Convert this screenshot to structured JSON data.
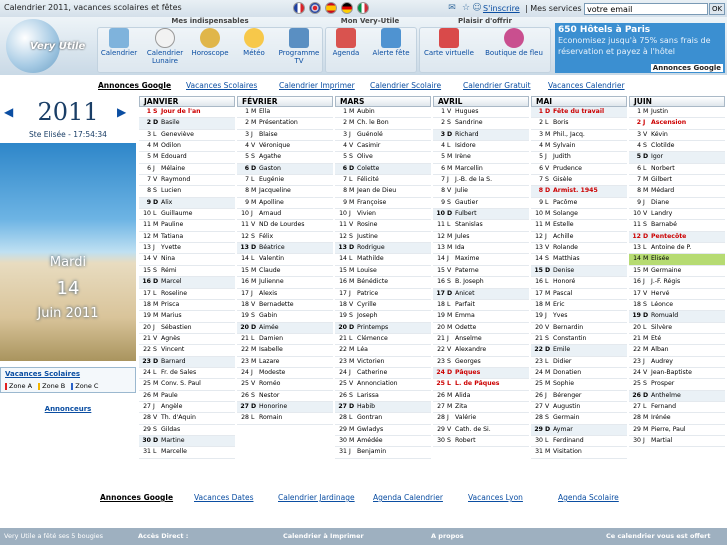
{
  "top": {
    "title": "Calendrier 2011, vacances scolaires et fêtes",
    "inscrire": "S'inscrire",
    "services_label": "| Mes services :",
    "email_value": "votre email",
    "ok": "OK",
    "flags": [
      "fr",
      "uk",
      "de",
      "es",
      "it"
    ]
  },
  "nav": {
    "groups": [
      {
        "title": "Mes indispensables"
      },
      {
        "title": "Mon Very-Utile"
      },
      {
        "title": "Plaisir d'offrir"
      }
    ],
    "buttons": [
      {
        "label": "Calendrier",
        "icon": "calendar-icon",
        "color": "#7fb3dc"
      },
      {
        "label": "Calendrier Lunaire",
        "icon": "moon-icon",
        "color": "#f2f2f2"
      },
      {
        "label": "Horoscope",
        "icon": "zodiac-icon",
        "color": "#e0b64a"
      },
      {
        "label": "Météo",
        "icon": "weather-icon",
        "color": "#f7c84a"
      },
      {
        "label": "Programme TV",
        "icon": "tv-icon",
        "color": "#5a8fc2"
      },
      {
        "label": "Agenda",
        "icon": "agenda-icon",
        "color": "#d9534f"
      },
      {
        "label": "Alerte fête",
        "icon": "mail-alert-icon",
        "color": "#4f93d1"
      },
      {
        "label": "Carte virtuelle",
        "icon": "greeting-card-icon",
        "color": "#d94a4a"
      },
      {
        "label": "Boutique de fleu",
        "icon": "flower-icon",
        "color": "#c94f8f"
      }
    ]
  },
  "promo": {
    "title": "650 Hôtels à Paris",
    "text": "Economisez jusqu'à 75% sans frais de réservation et payez à l'hôtel",
    "url_text": "www.booking.com/Paris",
    "badge": "Annonces Google"
  },
  "linkbar": [
    "Annonces Google",
    "Vacances Scolaires",
    "Calendrier Imprimer",
    "Calendrier Scolaire",
    "Calendrier Gratuit",
    "Vacances Calendrier"
  ],
  "side": {
    "year": "2011",
    "place_time": "Ste Elisée - 17:54:34",
    "photo_day": "Mardi",
    "photo_date": "14",
    "photo_month": "Juin 2011",
    "vacs_title": "Vacances Scolaires",
    "zones": [
      "Zone A",
      "Zone B",
      "Zone C"
    ],
    "zone_colors": [
      "#e11f1f",
      "#f2b500",
      "#2a62c9"
    ],
    "annonceurs": "Annonceurs"
  },
  "months": [
    {
      "name": "JANVIER",
      "days": [
        [
          "1",
          "S",
          "Jour de l'an"
        ],
        [
          "2",
          "D",
          "Basile"
        ],
        [
          "3",
          "L",
          "Geneviève"
        ],
        [
          "4",
          "M",
          "Odilon"
        ],
        [
          "5",
          "M",
          "Edouard"
        ],
        [
          "6",
          "J",
          "Mélaine"
        ],
        [
          "7",
          "V",
          "Raymond"
        ],
        [
          "8",
          "S",
          "Lucien"
        ],
        [
          "9",
          "D",
          "Alix"
        ],
        [
          "10",
          "L",
          "Guillaume"
        ],
        [
          "11",
          "M",
          "Pauline"
        ],
        [
          "12",
          "M",
          "Tatiana"
        ],
        [
          "13",
          "J",
          "Yvette"
        ],
        [
          "14",
          "V",
          "Nina"
        ],
        [
          "15",
          "S",
          "Rémi"
        ],
        [
          "16",
          "D",
          "Marcel"
        ],
        [
          "17",
          "L",
          "Roseline"
        ],
        [
          "18",
          "M",
          "Prisca"
        ],
        [
          "19",
          "M",
          "Marius"
        ],
        [
          "20",
          "J",
          "Sébastien"
        ],
        [
          "21",
          "V",
          "Agnès"
        ],
        [
          "22",
          "S",
          "Vincent"
        ],
        [
          "23",
          "D",
          "Barnard"
        ],
        [
          "24",
          "L",
          "Fr. de Sales"
        ],
        [
          "25",
          "M",
          "Conv. S. Paul"
        ],
        [
          "26",
          "M",
          "Paule"
        ],
        [
          "27",
          "J",
          "Angèle"
        ],
        [
          "28",
          "V",
          "Th. d'Aquin"
        ],
        [
          "29",
          "S",
          "Gildas"
        ],
        [
          "30",
          "D",
          "Martine"
        ],
        [
          "31",
          "L",
          "Marcelle"
        ]
      ]
    },
    {
      "name": "FÉVRIER",
      "days": [
        [
          "1",
          "M",
          "Ella"
        ],
        [
          "2",
          "M",
          "Présentation"
        ],
        [
          "3",
          "J",
          "Blaise"
        ],
        [
          "4",
          "V",
          "Véronique"
        ],
        [
          "5",
          "S",
          "Agathe"
        ],
        [
          "6",
          "D",
          "Gaston"
        ],
        [
          "7",
          "L",
          "Eugénie"
        ],
        [
          "8",
          "M",
          "Jacqueline"
        ],
        [
          "9",
          "M",
          "Apolline"
        ],
        [
          "10",
          "J",
          "Arnaud"
        ],
        [
          "11",
          "V",
          "ND de Lourdes"
        ],
        [
          "12",
          "S",
          "Félix"
        ],
        [
          "13",
          "D",
          "Béatrice"
        ],
        [
          "14",
          "L",
          "Valentin"
        ],
        [
          "15",
          "M",
          "Claude"
        ],
        [
          "16",
          "M",
          "Julienne"
        ],
        [
          "17",
          "J",
          "Alexis"
        ],
        [
          "18",
          "V",
          "Bernadette"
        ],
        [
          "19",
          "S",
          "Gabin"
        ],
        [
          "20",
          "D",
          "Aimée"
        ],
        [
          "21",
          "L",
          "Damien"
        ],
        [
          "22",
          "M",
          "Isabelle"
        ],
        [
          "23",
          "M",
          "Lazare"
        ],
        [
          "24",
          "J",
          "Modeste"
        ],
        [
          "25",
          "V",
          "Roméo"
        ],
        [
          "26",
          "S",
          "Nestor"
        ],
        [
          "27",
          "D",
          "Honorine"
        ],
        [
          "28",
          "L",
          "Romain"
        ]
      ]
    },
    {
      "name": "MARS",
      "days": [
        [
          "1",
          "M",
          "Aubin"
        ],
        [
          "2",
          "M",
          "Ch. le Bon"
        ],
        [
          "3",
          "J",
          "Guénolé"
        ],
        [
          "4",
          "V",
          "Casimir"
        ],
        [
          "5",
          "S",
          "Olive"
        ],
        [
          "6",
          "D",
          "Colette"
        ],
        [
          "7",
          "L",
          "Félicité"
        ],
        [
          "8",
          "M",
          "Jean de Dieu"
        ],
        [
          "9",
          "M",
          "Françoise"
        ],
        [
          "10",
          "J",
          "Vivien"
        ],
        [
          "11",
          "V",
          "Rosine"
        ],
        [
          "12",
          "S",
          "Justine"
        ],
        [
          "13",
          "D",
          "Rodrigue"
        ],
        [
          "14",
          "L",
          "Mathilde"
        ],
        [
          "15",
          "M",
          "Louise"
        ],
        [
          "16",
          "M",
          "Bénédicte"
        ],
        [
          "17",
          "J",
          "Patrice"
        ],
        [
          "18",
          "V",
          "Cyrille"
        ],
        [
          "19",
          "S",
          "Joseph"
        ],
        [
          "20",
          "D",
          "Printemps"
        ],
        [
          "21",
          "L",
          "Clémence"
        ],
        [
          "22",
          "M",
          "Léa"
        ],
        [
          "23",
          "M",
          "Victorien"
        ],
        [
          "24",
          "J",
          "Catherine"
        ],
        [
          "25",
          "V",
          "Annonciation"
        ],
        [
          "26",
          "S",
          "Larissa"
        ],
        [
          "27",
          "D",
          "Habib"
        ],
        [
          "28",
          "L",
          "Gontran"
        ],
        [
          "29",
          "M",
          "Gwladys"
        ],
        [
          "30",
          "M",
          "Amédée"
        ],
        [
          "31",
          "J",
          "Benjamin"
        ]
      ]
    },
    {
      "name": "AVRIL",
      "days": [
        [
          "1",
          "V",
          "Hugues"
        ],
        [
          "2",
          "S",
          "Sandrine"
        ],
        [
          "3",
          "D",
          "Richard"
        ],
        [
          "4",
          "L",
          "Isidore"
        ],
        [
          "5",
          "M",
          "Irène"
        ],
        [
          "6",
          "M",
          "Marcellin"
        ],
        [
          "7",
          "J",
          "J.-B. de la S."
        ],
        [
          "8",
          "V",
          "Julie"
        ],
        [
          "9",
          "S",
          "Gautier"
        ],
        [
          "10",
          "D",
          "Fulbert"
        ],
        [
          "11",
          "L",
          "Stanislas"
        ],
        [
          "12",
          "M",
          "Jules"
        ],
        [
          "13",
          "M",
          "Ida"
        ],
        [
          "14",
          "J",
          "Maxime"
        ],
        [
          "15",
          "V",
          "Paterne"
        ],
        [
          "16",
          "S",
          "B. Joseph"
        ],
        [
          "17",
          "D",
          "Anicet"
        ],
        [
          "18",
          "L",
          "Parfait"
        ],
        [
          "19",
          "M",
          "Emma"
        ],
        [
          "20",
          "M",
          "Odette"
        ],
        [
          "21",
          "J",
          "Anselme"
        ],
        [
          "22",
          "V",
          "Alexandre"
        ],
        [
          "23",
          "S",
          "Georges"
        ],
        [
          "24",
          "D",
          "Pâques"
        ],
        [
          "25",
          "L",
          "L. de Pâques"
        ],
        [
          "26",
          "M",
          "Alida"
        ],
        [
          "27",
          "M",
          "Zita"
        ],
        [
          "28",
          "J",
          "Valérie"
        ],
        [
          "29",
          "V",
          "Cath. de Si."
        ],
        [
          "30",
          "S",
          "Robert"
        ]
      ]
    },
    {
      "name": "MAI",
      "days": [
        [
          "1",
          "D",
          "Fête du travail"
        ],
        [
          "2",
          "L",
          "Boris"
        ],
        [
          "3",
          "M",
          "Phil., Jacq."
        ],
        [
          "4",
          "M",
          "Sylvain"
        ],
        [
          "5",
          "J",
          "Judith"
        ],
        [
          "6",
          "V",
          "Prudence"
        ],
        [
          "7",
          "S",
          "Gisèle"
        ],
        [
          "8",
          "D",
          "Armist. 1945"
        ],
        [
          "9",
          "L",
          "Pacôme"
        ],
        [
          "10",
          "M",
          "Solange"
        ],
        [
          "11",
          "M",
          "Estelle"
        ],
        [
          "12",
          "J",
          "Achille"
        ],
        [
          "13",
          "V",
          "Rolande"
        ],
        [
          "14",
          "S",
          "Matthias"
        ],
        [
          "15",
          "D",
          "Denise"
        ],
        [
          "16",
          "L",
          "Honoré"
        ],
        [
          "17",
          "M",
          "Pascal"
        ],
        [
          "18",
          "M",
          "Eric"
        ],
        [
          "19",
          "J",
          "Yves"
        ],
        [
          "20",
          "V",
          "Bernardin"
        ],
        [
          "21",
          "S",
          "Constantin"
        ],
        [
          "22",
          "D",
          "Emile"
        ],
        [
          "23",
          "L",
          "Didier"
        ],
        [
          "24",
          "M",
          "Donatien"
        ],
        [
          "25",
          "M",
          "Sophie"
        ],
        [
          "26",
          "J",
          "Bérenger"
        ],
        [
          "27",
          "V",
          "Augustin"
        ],
        [
          "28",
          "S",
          "Germain"
        ],
        [
          "29",
          "D",
          "Aymar"
        ],
        [
          "30",
          "L",
          "Ferdinand"
        ],
        [
          "31",
          "M",
          "Visitation"
        ]
      ]
    },
    {
      "name": "JUIN",
      "days": [
        [
          "1",
          "M",
          "Justin"
        ],
        [
          "2",
          "J",
          "Ascension"
        ],
        [
          "3",
          "V",
          "Kévin"
        ],
        [
          "4",
          "S",
          "Clotilde"
        ],
        [
          "5",
          "D",
          "Igor"
        ],
        [
          "6",
          "L",
          "Norbert"
        ],
        [
          "7",
          "M",
          "Gilbert"
        ],
        [
          "8",
          "M",
          "Médard"
        ],
        [
          "9",
          "J",
          "Diane"
        ],
        [
          "10",
          "V",
          "Landry"
        ],
        [
          "11",
          "S",
          "Barnabé"
        ],
        [
          "12",
          "D",
          "Pentecôte"
        ],
        [
          "13",
          "L",
          "Antoine de P."
        ],
        [
          "14",
          "M",
          "Elisée"
        ],
        [
          "15",
          "M",
          "Germaine"
        ],
        [
          "16",
          "J",
          "J.-F. Régis"
        ],
        [
          "17",
          "V",
          "Hervé"
        ],
        [
          "18",
          "S",
          "Léonce"
        ],
        [
          "19",
          "D",
          "Romuald"
        ],
        [
          "20",
          "L",
          "Silvère"
        ],
        [
          "21",
          "M",
          "Eté"
        ],
        [
          "22",
          "M",
          "Alban"
        ],
        [
          "23",
          "J",
          "Audrey"
        ],
        [
          "24",
          "V",
          "Jean-Baptiste"
        ],
        [
          "25",
          "S",
          "Prosper"
        ],
        [
          "26",
          "D",
          "Anthelme"
        ],
        [
          "27",
          "L",
          "Fernand"
        ],
        [
          "28",
          "M",
          "Irénée"
        ],
        [
          "29",
          "M",
          "Pierre, Paul"
        ],
        [
          "30",
          "J",
          "Martial"
        ]
      ]
    }
  ],
  "bottomlinks": [
    "Annonces Google",
    "Vacances Dates",
    "Calendrier Jardinage",
    "Agenda Calendrier",
    "Vacances Lyon",
    "Agenda Scolaire"
  ],
  "footer": [
    "Very Utile a fêté ses 5 bougies",
    "Accès Direct :",
    "Calendrier à Imprimer",
    "A propos",
    "Ce calendrier vous est offert"
  ]
}
